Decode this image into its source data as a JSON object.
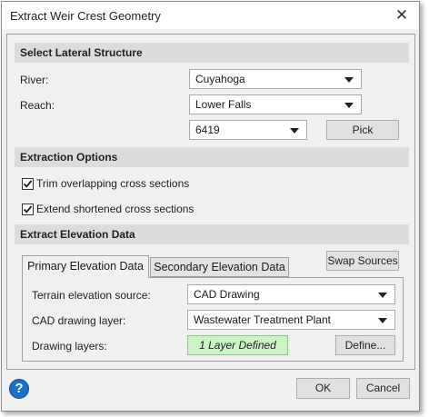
{
  "window": {
    "title": "Extract Weir Crest Geometry",
    "close_glyph": "✕"
  },
  "lateral": {
    "header": "Select Lateral Structure",
    "river_label": "River:",
    "river_value": "Cuyahoga",
    "reach_label": "Reach:",
    "reach_value": "Lower Falls",
    "station_value": "6419",
    "pick_label": "Pick"
  },
  "extraction": {
    "header": "Extraction Options",
    "trim_label": "Trim overlapping cross sections",
    "trim_checked": true,
    "extend_label": "Extend shortened cross sections",
    "extend_checked": true
  },
  "elevation": {
    "header": "Extract Elevation Data",
    "tabs": [
      {
        "label": "Primary Elevation Data",
        "selected": true
      },
      {
        "label": "Secondary Elevation Data",
        "selected": false
      }
    ],
    "swap_label": "Swap Sources",
    "terrain_label": "Terrain elevation source:",
    "terrain_value": "CAD Drawing",
    "cad_layer_label": "CAD drawing layer:",
    "cad_layer_value": "Wastewater Treatment Plant",
    "drawing_layers_label": "Drawing layers:",
    "drawing_layers_value": "1 Layer Defined",
    "define_label": "Define..."
  },
  "footer": {
    "help_glyph": "?",
    "ok_label": "OK",
    "cancel_label": "Cancel"
  },
  "colors": {
    "accent": "#1e6fc7",
    "status_green": "#ccf2c7"
  },
  "icons": {
    "close": "close-icon",
    "help": "help-icon",
    "checkbox": "check-icon",
    "dropdown": "chevron-down-icon"
  }
}
